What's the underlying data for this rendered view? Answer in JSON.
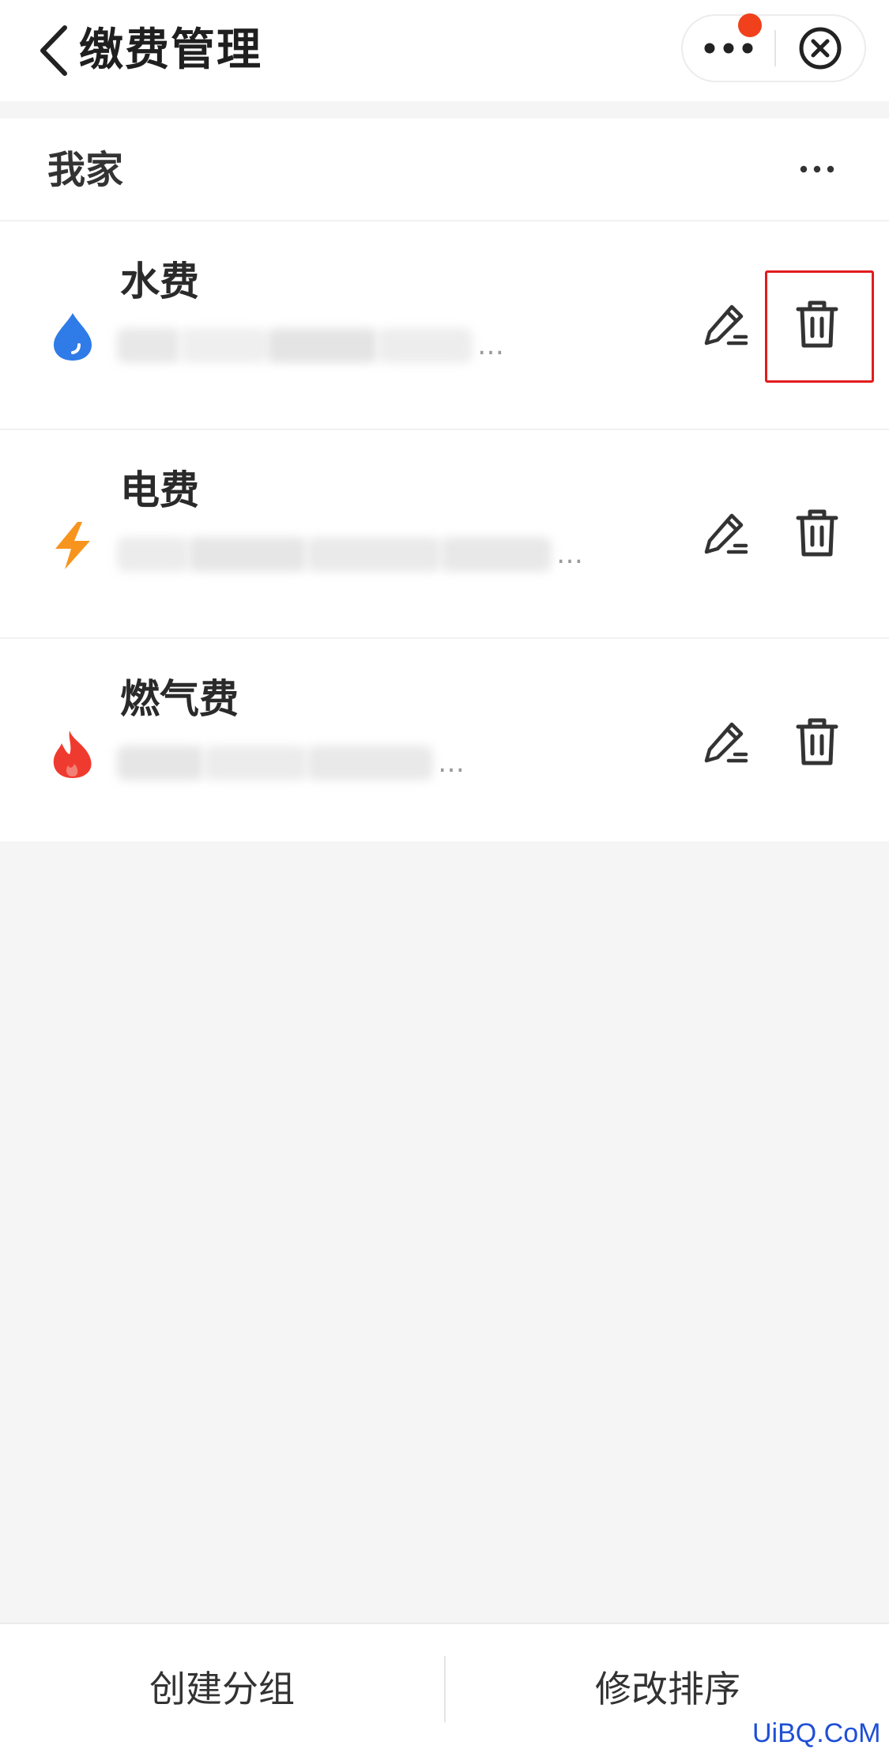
{
  "nav": {
    "title": "缴费管理"
  },
  "group": {
    "name": "我家"
  },
  "bills": [
    {
      "name": "水费",
      "icon": "water-drop-icon",
      "icon_color": "#2f7be8"
    },
    {
      "name": "电费",
      "icon": "lightning-icon",
      "icon_color": "#f7941d"
    },
    {
      "name": "燃气费",
      "icon": "flame-icon",
      "icon_color": "#ef3b2f"
    }
  ],
  "footer": {
    "create_group": "创建分组",
    "reorder": "修改排序"
  },
  "watermark": "UiBQ.CoM",
  "colors": {
    "highlight": "#e21c1c",
    "notification_dot": "#f0401c",
    "watermark": "#1f4fd6"
  }
}
